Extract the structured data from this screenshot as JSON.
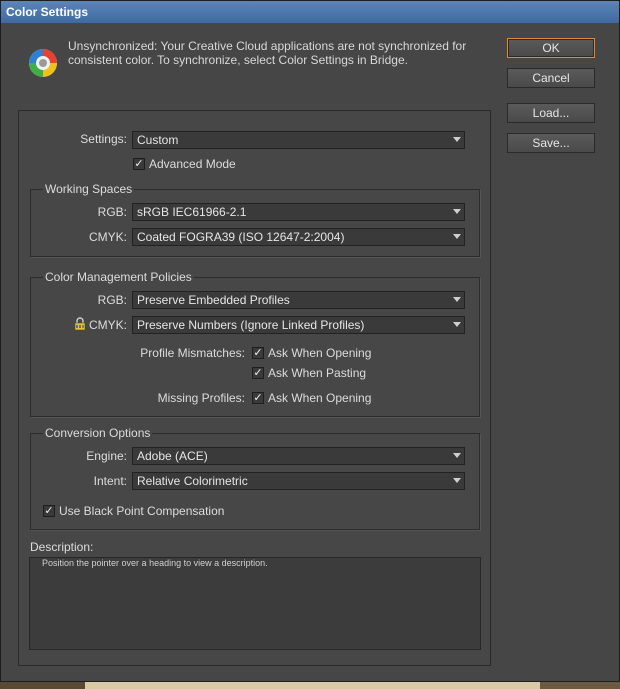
{
  "window": {
    "title": "Color Settings"
  },
  "sync": {
    "message": "Unsynchronized: Your Creative Cloud applications are not synchronized for consistent color. To synchronize, select Color Settings in Bridge."
  },
  "buttons": {
    "ok": "OK",
    "cancel": "Cancel",
    "load": "Load...",
    "save": "Save..."
  },
  "settings": {
    "label": "Settings:",
    "value": "Custom",
    "advanced_mode_label": "Advanced Mode",
    "advanced_mode_checked": true
  },
  "working_spaces": {
    "title": "Working Spaces",
    "rgb_label": "RGB:",
    "rgb_value": "sRGB IEC61966-2.1",
    "cmyk_label": "CMYK:",
    "cmyk_value": "Coated FOGRA39 (ISO 12647-2:2004)"
  },
  "policies": {
    "title": "Color Management Policies",
    "rgb_label": "RGB:",
    "rgb_value": "Preserve Embedded Profiles",
    "cmyk_label": "CMYK:",
    "cmyk_value": "Preserve Numbers (Ignore Linked Profiles)",
    "profile_mismatches_label": "Profile Mismatches:",
    "ask_when_opening_label": "Ask When Opening",
    "ask_when_pasting_label": "Ask When Pasting",
    "missing_profiles_label": "Missing Profiles:",
    "missing_ask_when_opening_label": "Ask When Opening"
  },
  "conversion": {
    "title": "Conversion Options",
    "engine_label": "Engine:",
    "engine_value": "Adobe (ACE)",
    "intent_label": "Intent:",
    "intent_value": "Relative Colorimetric",
    "black_point_label": "Use Black Point Compensation"
  },
  "description": {
    "title": "Description:",
    "text": "Position the pointer over a heading to view a description."
  },
  "icons": {
    "sync": "color-sync-wheel-icon",
    "lock": "lock-icon",
    "dropdown": "chevron-down-icon",
    "check": "checkmark-icon"
  },
  "colors": {
    "dialog_bg": "#464646",
    "titlebar": "#4a74ab",
    "default_button_border": "#e08a2a"
  }
}
